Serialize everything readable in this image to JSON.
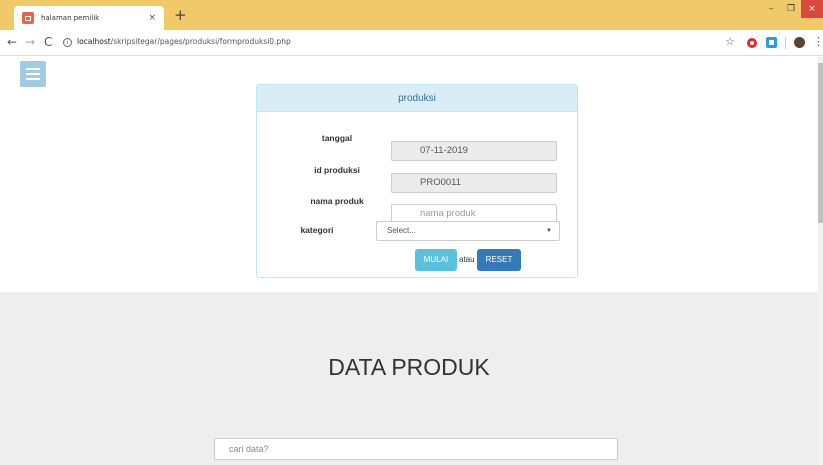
{
  "browser": {
    "tab_title": "halaman pemilik",
    "tab_close": "×",
    "new_tab": "+",
    "url_host": "localhost",
    "url_path": "/skripsitegar/pages/produksi/formproduksi0.php",
    "window_controls": {
      "minimize": "–",
      "maximize": "❐",
      "close": "×"
    },
    "nav": {
      "back": "←",
      "forward": "→",
      "reload": "C",
      "info": "i",
      "bookmark": "☆",
      "menu": "⋮"
    }
  },
  "form": {
    "heading": "produksi",
    "fields": [
      {
        "label": "tanggal",
        "value": "07-11-2019",
        "placeholder": ""
      },
      {
        "label": "id produksi",
        "value": "PRO0011",
        "placeholder": ""
      },
      {
        "label": "nama produk",
        "value": "",
        "placeholder": "nama produk"
      },
      {
        "label": "kategori",
        "value": "Select...",
        "placeholder": ""
      }
    ],
    "start_button": "MULAI",
    "or_text": "atau",
    "reset_button": "RESET"
  },
  "data_section": {
    "title": "DATA PRODUK",
    "search_placeholder": "cari data?"
  },
  "colors": {
    "titlebar": "#f0c96b",
    "panel_heading_bg": "#d9edf7",
    "panel_heading_text": "#31708f",
    "btn_mulai": "#5bc0de",
    "btn_reset": "#337ab7",
    "hamburger": "#9fcbe3"
  },
  "icons": {
    "hamburger": "menu-icon",
    "favicon": "page-favicon-icon",
    "select_caret": "caret-down-icon"
  }
}
